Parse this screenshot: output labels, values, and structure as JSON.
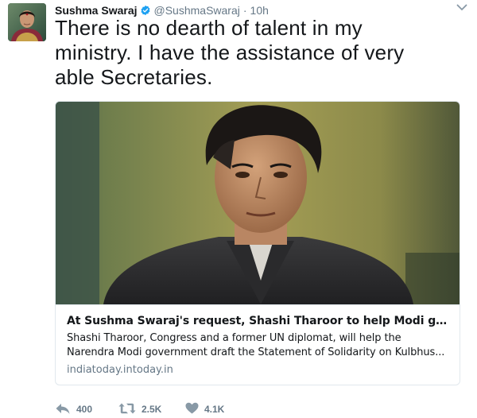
{
  "tweet": {
    "author_name": "Sushma Swaraj",
    "author_handle": "@SushmaSwaraj",
    "separator": "·",
    "time": "10h",
    "text": "There is no dearth of talent in my\nministry. I have the assistance of very\nable Secretaries.",
    "avatar_icon": "profile-photo",
    "verified_icon": "verified-badge",
    "caret_icon": "chevron-down-icon"
  },
  "card": {
    "image_icon": "article-photo",
    "title": "At Sushma Swaraj's request, Shashi Tharoor to help Modi governme...",
    "description_line1": "Shashi Tharoor, Congress and a former UN diplomat, will help the",
    "description_line2": "Narendra Modi government draft the Statement of Solidarity on Kulbhus...",
    "domain": "indiatoday.intoday.in"
  },
  "actions": {
    "reply_count": "400",
    "retweet_count": "2.5K",
    "like_count": "4.1K",
    "reply_icon": "reply-icon",
    "retweet_icon": "retweet-icon",
    "like_icon": "heart-icon"
  },
  "colors": {
    "text": "#14171a",
    "secondary": "#657786",
    "verified": "#1da1f2",
    "border": "#e1e8ed"
  }
}
